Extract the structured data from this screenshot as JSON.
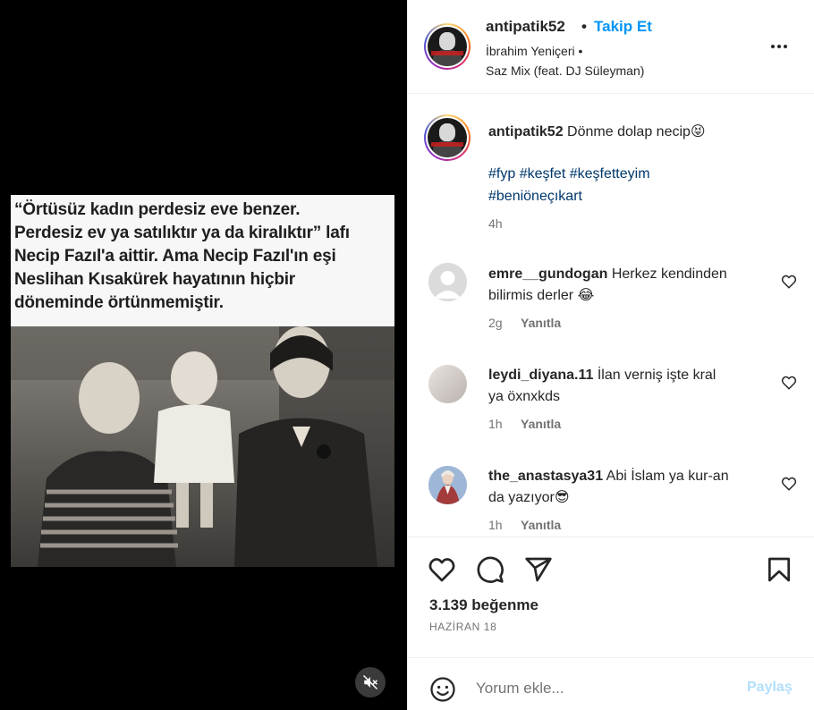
{
  "post": {
    "caption_lines": "“Örtüsüz kadın perdesiz eve benzer.\nPerdesiz ev ya satılıktır ya da kiralıktır” lafı\nNecip Fazıl'a aittir. Ama  Necip Fazıl'ın eşi\nNeslihan Kısakürek hayatının hiçbir\ndöneminde örtünmemiştir."
  },
  "header": {
    "username": "antipatik52",
    "dot": "•",
    "follow_label": "Takip Et",
    "audio_artist": "İbrahim Yeniçeri •",
    "audio_track": "Saz Mix (feat. DJ Süleyman)"
  },
  "caption": {
    "username": "antipatik52",
    "text": "Dönme dolap necip",
    "emoji": "😝",
    "hashtags_line1": "#fyp #keşfet #keşfetteyim",
    "hashtags_line2": "#beniöneçıkart",
    "time": "4h"
  },
  "comments": [
    {
      "username": "emre__gundogan",
      "text_line1": "Herkez kendinden",
      "text_line2": "bilirmis derler",
      "emoji": "😂",
      "time": "2g",
      "reply_label": "Yanıtla"
    },
    {
      "username": "leydi_diyana.11",
      "text_line1": "İlan verniş işte kral",
      "text_line2": "ya öxnxkds",
      "emoji": "",
      "time": "1h",
      "reply_label": "Yanıtla"
    },
    {
      "username": "the_anastasya31",
      "text_line1": "Abi İslam ya kur-an",
      "text_line2": "da yazıyor",
      "emoji": "😎",
      "time": "1h",
      "reply_label": "Yanıtla"
    }
  ],
  "actions": {
    "likes": "3.139 beğenme",
    "date": "HAZİRAN 18"
  },
  "composer": {
    "placeholder": "Yorum ekle...",
    "post_label": "Paylaş"
  },
  "colors": {
    "accent": "#0095f6",
    "hashtag": "#00376b",
    "muted": "#737373",
    "post_disabled": "#b2dffc"
  },
  "icons": [
    "more-options-icon",
    "heart-icon",
    "comment-icon",
    "share-icon",
    "bookmark-icon",
    "emoji-icon",
    "mute-icon"
  ]
}
